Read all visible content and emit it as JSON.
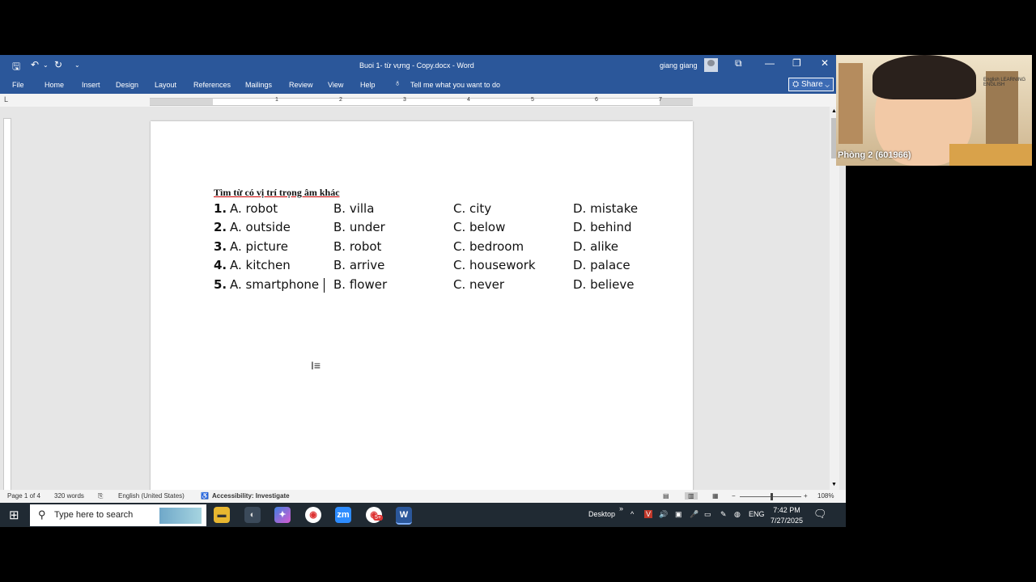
{
  "word": {
    "window_title": "Buoi 1- từ vựng - Copy.docx  -  Word",
    "user_name": "giang giang",
    "ribbon_tabs": [
      "File",
      "Home",
      "Insert",
      "Design",
      "Layout",
      "References",
      "Mailings",
      "Review",
      "View",
      "Help"
    ],
    "tell_me": "Tell me what you want to do",
    "share_label": "Share",
    "ruler_numbers": [
      "1",
      "1",
      "2",
      "3",
      "4",
      "5",
      "6",
      "7"
    ]
  },
  "document": {
    "title": "Tìm từ có vị trí trọng âm khác",
    "questions": [
      {
        "num": "1.",
        "a": "A. robot",
        "b": "B. villa",
        "c": "C. city",
        "d": "D. mistake"
      },
      {
        "num": "2.",
        "a": "A. outside",
        "b": "B. under",
        "c": "C. below",
        "d": "D. behind"
      },
      {
        "num": "3.",
        "a": "A. picture",
        "b": "B. robot",
        "c": "C. bedroom",
        "d": "D. alike"
      },
      {
        "num": "4.",
        "a": "A. kitchen",
        "b": "B. arrive",
        "c": "C. housework",
        "d": "D. palace"
      },
      {
        "num": "5.",
        "a": "A. smartphone",
        "b": "B. flower",
        "c": "C. never",
        "d": "D. believe"
      }
    ]
  },
  "status_bar": {
    "page": "Page 1 of 4",
    "words": "320 words",
    "language": "English (United States)",
    "accessibility": "Accessibility: Investigate",
    "zoom": "108%"
  },
  "taskbar": {
    "search_placeholder": "Type here to search",
    "desktop_label": "Desktop",
    "lang": "ENG",
    "time": "7:42 PM",
    "date": "7/27/2025",
    "chrome_badge": "5+"
  },
  "video": {
    "participant_label": "Phòng 2 (601966)",
    "sign_text": "English LEARNING ENGLISH"
  }
}
